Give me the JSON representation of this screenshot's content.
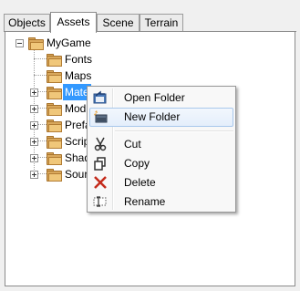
{
  "tabs": [
    {
      "label": "Objects",
      "active": false
    },
    {
      "label": "Assets",
      "active": true
    },
    {
      "label": "Scene",
      "active": false
    },
    {
      "label": "Terrain",
      "active": false
    }
  ],
  "tree": {
    "root": {
      "label": "MyGame",
      "expanded": true
    },
    "children": [
      {
        "label": "Fonts",
        "expandable": false
      },
      {
        "label": "Maps",
        "expandable": false
      },
      {
        "label": "Mate",
        "expandable": true,
        "selected": true
      },
      {
        "label": "Mod",
        "expandable": true
      },
      {
        "label": "Prefa",
        "expandable": true
      },
      {
        "label": "Scrip",
        "expandable": true
      },
      {
        "label": "Shad",
        "expandable": true
      },
      {
        "label": "Sour",
        "expandable": true
      }
    ]
  },
  "context_menu": {
    "items": [
      {
        "label": "Open Folder",
        "icon": "open-folder-icon"
      },
      {
        "label": "New Folder",
        "icon": "new-folder-icon",
        "highlighted": true
      },
      {
        "label": "Cut",
        "icon": "scissors-icon"
      },
      {
        "label": "Copy",
        "icon": "copy-icon"
      },
      {
        "label": "Delete",
        "icon": "delete-x-icon"
      },
      {
        "label": "Rename",
        "icon": "rename-icon"
      }
    ]
  },
  "colors": {
    "selection": "#3399ff",
    "menu_highlight_border": "#a8c8ec",
    "folder": "#d9a85c",
    "delete_red": "#c42b1c"
  }
}
